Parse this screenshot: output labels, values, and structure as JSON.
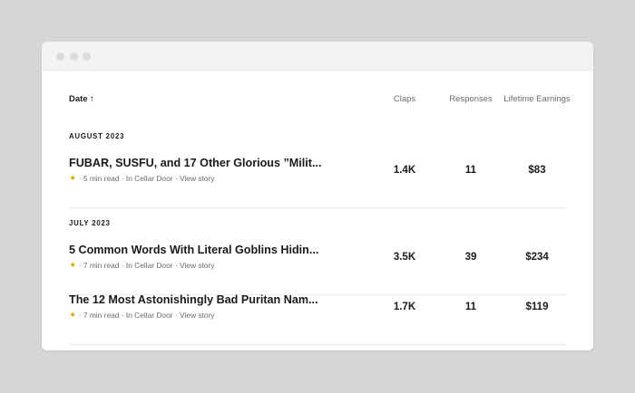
{
  "table": {
    "headers": {
      "date": "Date",
      "date_sort_icon": "arrow-up-icon",
      "claps": "Claps",
      "responses": "Responses",
      "earnings": "Lifetime Earnings"
    }
  },
  "groups": [
    {
      "label": "AUGUST 2023",
      "stories": [
        {
          "title": "FUBAR, SUSFU, and 17 Other Glorious ”Milit...",
          "read_time": "5 min read",
          "publication": "In Cellar Door",
          "view": "View story",
          "claps": "1.4K",
          "responses": "11",
          "earnings": "$83"
        }
      ]
    },
    {
      "label": "JULY 2023",
      "stories": [
        {
          "title": "5 Common Words With Literal Goblins Hidin...",
          "read_time": "7 min read",
          "publication": "In Cellar Door",
          "view": "View story",
          "claps": "3.5K",
          "responses": "39",
          "earnings": "$234"
        },
        {
          "title": "The 12 Most Astonishingly Bad Puritan Nam...",
          "read_time": "7 min read",
          "publication": "In Cellar Door",
          "view": "View story",
          "claps": "1.7K",
          "responses": "11",
          "earnings": "$119"
        }
      ]
    }
  ],
  "colors": {
    "member_star": "#e0a800",
    "divider": "#ececec"
  }
}
